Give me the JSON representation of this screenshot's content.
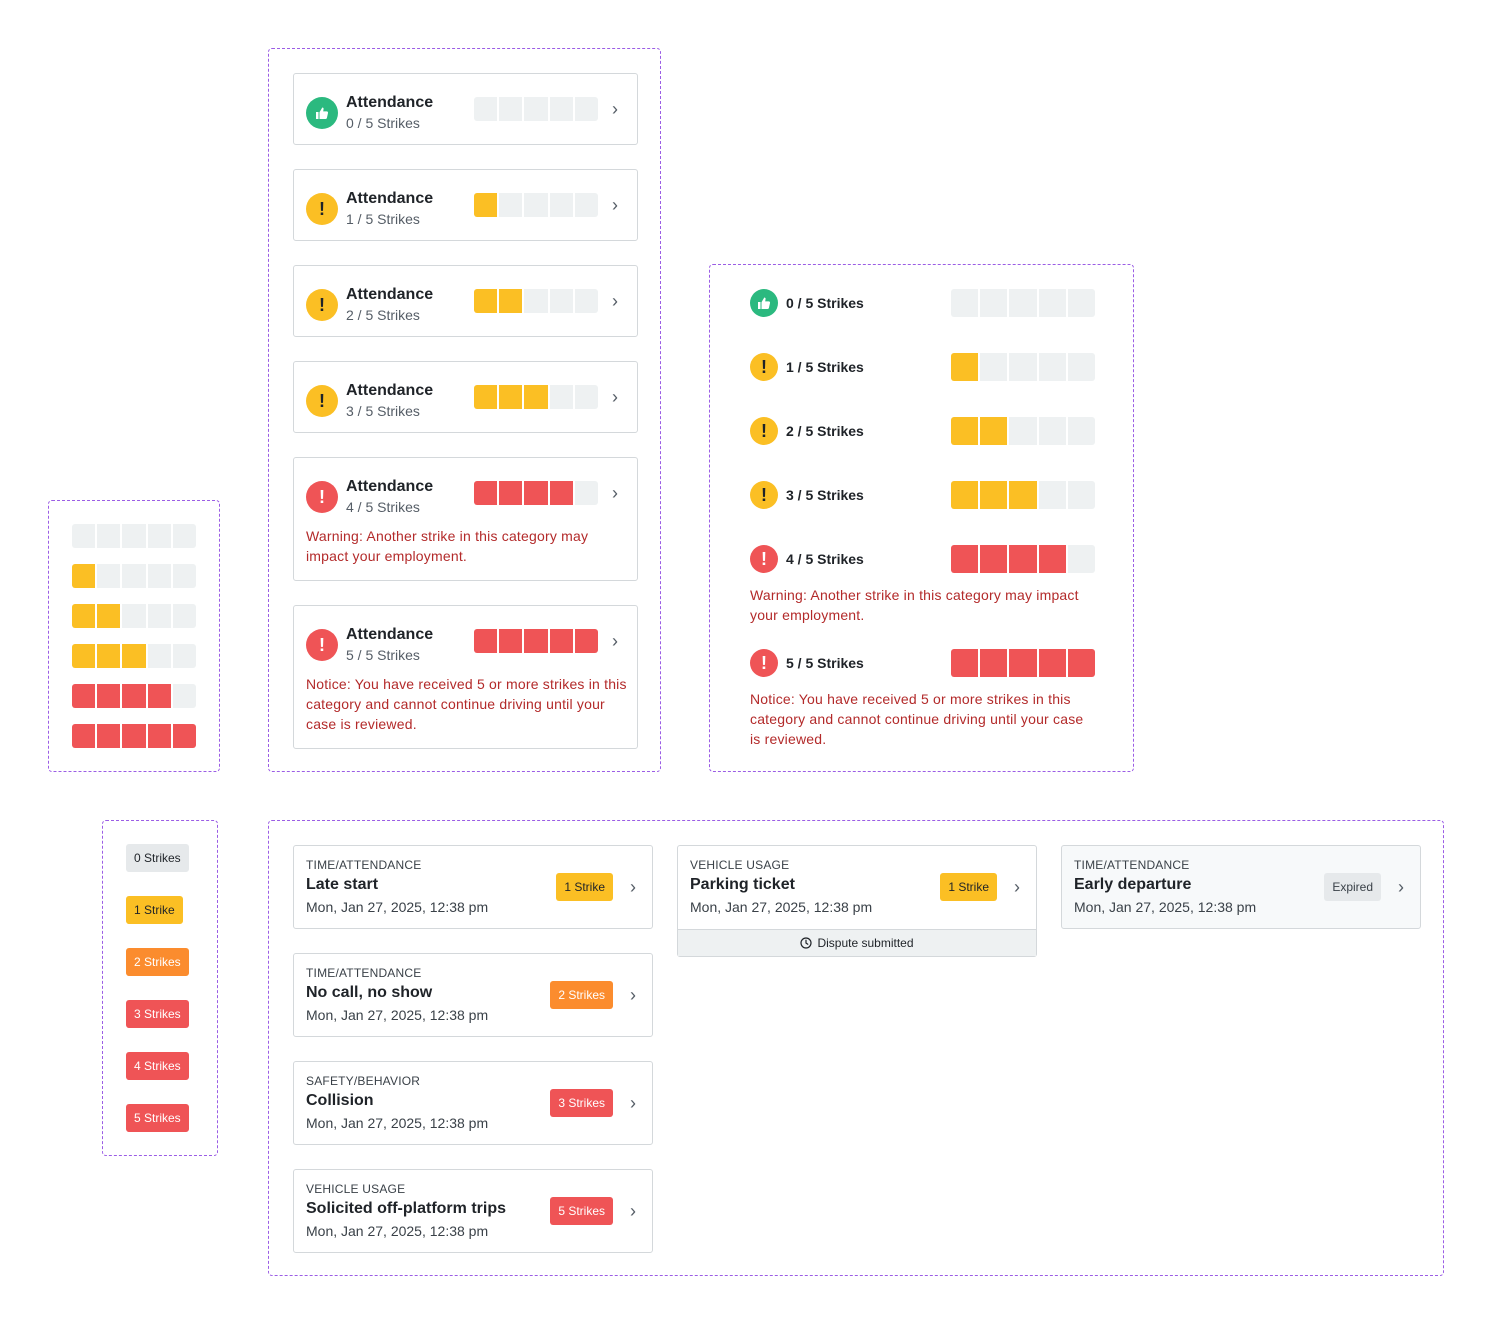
{
  "bars": [
    0,
    1,
    2,
    3,
    4,
    5
  ],
  "category_cards": [
    {
      "title": "Attendance",
      "subtitle": "0 / 5 Strikes",
      "level": 0,
      "status": "good",
      "message": ""
    },
    {
      "title": "Attendance",
      "subtitle": "1 / 5 Strikes",
      "level": 1,
      "status": "warn",
      "message": ""
    },
    {
      "title": "Attendance",
      "subtitle": "2 / 5 Strikes",
      "level": 2,
      "status": "warn",
      "message": ""
    },
    {
      "title": "Attendance",
      "subtitle": "3 / 5 Strikes",
      "level": 3,
      "status": "warn",
      "message": ""
    },
    {
      "title": "Attendance",
      "subtitle": "4 / 5 Strikes",
      "level": 4,
      "status": "bad",
      "message": "Warning: Another strike in this category may impact your employment."
    },
    {
      "title": "Attendance",
      "subtitle": "5 / 5 Strikes",
      "level": 5,
      "status": "bad",
      "message": "Notice: You have received 5 or more strikes in this category and cannot continue driving until your case is reviewed."
    }
  ],
  "compact_rows": [
    {
      "label": "0 / 5 Strikes",
      "level": 0,
      "status": "good"
    },
    {
      "label": "1 / 5 Strikes",
      "level": 1,
      "status": "warn"
    },
    {
      "label": "2 / 5 Strikes",
      "level": 2,
      "status": "warn"
    },
    {
      "label": "3 / 5 Strikes",
      "level": 3,
      "status": "warn"
    },
    {
      "label": "4 / 5 Strikes",
      "level": 4,
      "status": "bad"
    },
    {
      "label": "5 / 5 Strikes",
      "level": 5,
      "status": "bad"
    }
  ],
  "compact_messages": {
    "warning": "Warning: Another strike in this category may impact your employment.",
    "notice": "Notice: You have received 5 or more strikes in this category and cannot continue driving until your case is reviewed."
  },
  "chips": [
    {
      "label": "0 Strikes",
      "variant": "c0"
    },
    {
      "label": "1 Strike",
      "variant": "c1"
    },
    {
      "label": "2 Strikes",
      "variant": "c2"
    },
    {
      "label": "3 Strikes",
      "variant": "c3"
    },
    {
      "label": "4 Strikes",
      "variant": "c3"
    },
    {
      "label": "5 Strikes",
      "variant": "c3"
    }
  ],
  "incidents": [
    {
      "category": "TIME/ATTENDANCE",
      "name": "Late start",
      "date": "Mon, Jan 27, 2025, 12:38 pm",
      "chip": "1 Strike",
      "variant": "c1"
    },
    {
      "category": "TIME/ATTENDANCE",
      "name": "No call, no show",
      "date": "Mon, Jan 27, 2025, 12:38 pm",
      "chip": "2 Strikes",
      "variant": "c2"
    },
    {
      "category": "SAFETY/BEHAVIOR",
      "name": "Collision",
      "date": "Mon, Jan 27, 2025, 12:38 pm",
      "chip": "3 Strikes",
      "variant": "c3"
    },
    {
      "category": "VEHICLE USAGE",
      "name": "Solicited off-platform trips",
      "date": "Mon, Jan 27, 2025, 12:38 pm",
      "chip": "5 Strikes",
      "variant": "c3"
    }
  ],
  "incident_disputed": {
    "category": "VEHICLE USAGE",
    "name": "Parking ticket",
    "date": "Mon, Jan 27, 2025, 12:38 pm",
    "chip": "1 Strike",
    "variant": "c1",
    "footer": "Dispute submitted"
  },
  "incident_expired": {
    "category": "TIME/ATTENDANCE",
    "name": "Early departure",
    "date": "Mon, Jan 27, 2025, 12:38 pm",
    "chip": "Expired",
    "variant": "cx"
  },
  "colors": {
    "empty": "#eef1f2",
    "warn": "#fbbf24",
    "danger": "#ef5456",
    "orange": "#fb8c2e",
    "good": "#2bb97f",
    "frame": "#9b5de5",
    "message": "#b32a2a"
  },
  "icons": {
    "good": "thumbs-up-icon",
    "warn": "exclamation-icon",
    "bad": "exclamation-icon",
    "chevron": "chevron-right-icon",
    "clock": "clock-icon"
  }
}
